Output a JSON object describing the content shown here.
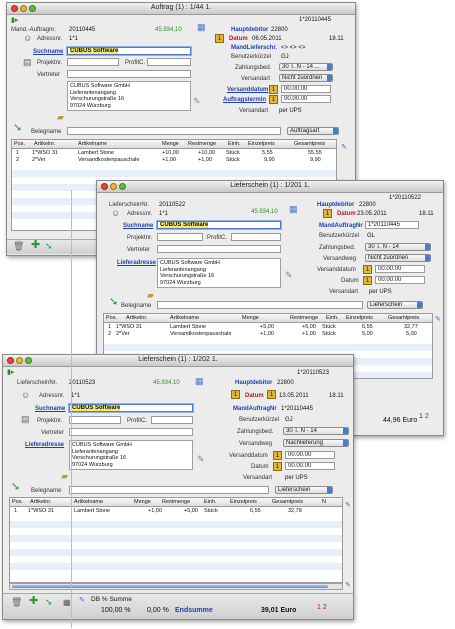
{
  "w1": {
    "title": "Auftrag (1) : 1/44 1.",
    "doc_no": "1*20110445",
    "lbl_mand": "Mand.-Auftragnr.",
    "mand": "20110445",
    "amount": "45.934,10",
    "lbl_hauptdebitor": "Hauptdebitor",
    "hauptdebitor": "22800",
    "lbl_datum": "Datum",
    "datum": "06.05.2011",
    "time": "18.11",
    "lbl_adressnr": "Adressnr.",
    "adressnr": "1*1",
    "lbl_mandlieferschein": "MandLieferschr.",
    "mandlieferschein": "<> <> <>",
    "lbl_suchname": "Suchname",
    "suchname": "CUBUS Software",
    "lbl_benutzer": "Benutzerkürzel",
    "benutzer": "GJ",
    "lbl_projekt": "Projektnr.",
    "lbl_profitc": "ProfitC.",
    "lbl_zahlung": "Zahlungsbed.",
    "zahlung": "30 T. N - 14 ...",
    "lbl_vertreter": "Vertreter",
    "lbl_versandart": "Versandart",
    "versandart": "Nicht zuordnen",
    "address": [
      "CUBUS Software GmbH",
      "Lieferantenangang",
      "Verschurungstraße 16",
      "97024 Würzburg"
    ],
    "lbl_versanddatum": "Versanddatum",
    "versanddatum": "00.00.00",
    "lbl_auftragstermin": "Auftragstermin",
    "auftragstermin": "00.00.00",
    "lbl_versandart2": "Versandart",
    "versandart2": "per UPS",
    "lbl_belegname": "Belegname",
    "belegname": "Auftragsart",
    "columns": [
      "Pos.",
      "Artikelnr.",
      "Artikelname",
      "Menge",
      "Restmenge",
      "Einh.",
      "Einzelpreis",
      "Gesamtpreis"
    ],
    "rows": [
      [
        "1",
        "1*WSO 31",
        "Lambert Stone",
        "+10,00",
        "+10,00",
        "Stück",
        "5,55",
        "55,55"
      ],
      [
        "2",
        "2*Ver",
        "Versandkostenpauschale",
        "+1,00",
        "+1,00",
        "Stück",
        "9,90",
        "9,90"
      ]
    ]
  },
  "w2": {
    "title": "Lieferschein (1) : 1/201 1.",
    "doc_no": "1*20110522",
    "lbl_mand": "LieferscheinNr.",
    "mand": "20110522",
    "amount": "45.934,10",
    "lbl_hauptdebitor": "Hauptdebitor",
    "hauptdebitor": "22800",
    "lbl_datum": "Datum",
    "datum": "23.05.2011",
    "time": "18.11",
    "lbl_adressnr": "Adressnr.",
    "adressnr": "1*1",
    "lbl_mandauftragnr": "MandAuftragNr",
    "mandauftragnr": "1*20110445",
    "lbl_suchname": "Suchname",
    "suchname": "CUBUS Software",
    "lbl_benutzer": "Benutzerkürzel",
    "benutzer": "GL",
    "lbl_projekt": "Projektnr.",
    "lbl_profitc": "ProfitC.",
    "lbl_zahlung": "Zahlungsbed.",
    "zahlung": "30 T. N - 14",
    "lbl_vertreter": "Vertreter",
    "lbl_versandweg": "Versandweg",
    "versandweg": "Nicht zuordnen",
    "lbl_lieferadresse": "Lieferadresse",
    "address": [
      "CUBUS Software GmbH",
      "Lieferantenangang",
      "Verschurungstraße 16",
      "97024 Würzburg"
    ],
    "lbl_versanddatum": "Versanddatum",
    "versanddatum": "00.00.00",
    "lbl_datum2": "Datum",
    "datum2": "00.00.00",
    "lbl_versandart": "Versandart",
    "versandart": "per UPS",
    "lbl_belegname": "Belegname",
    "belegname": "Lieferschein",
    "columns": [
      "Pos.",
      "Artikelnr.",
      "Artikelname",
      "Menge",
      "Restmenge",
      "Einh.",
      "Einzelpreis",
      "Gesamtpreis"
    ],
    "rows": [
      [
        "1",
        "1*WSO 31",
        "Lambert Stone",
        "+5,00",
        "+5,00",
        "Stück",
        "6,55",
        "32,77"
      ],
      [
        "2",
        "2*Ver",
        "Versandkostenpauschale",
        "+1,00",
        "+1,00",
        "Stück",
        "5,00",
        "5,00"
      ]
    ],
    "total": "44,96",
    "currency": "Euro",
    "page_a": "1",
    "page_b": "2"
  },
  "w3": {
    "title": "Lieferschein (1) : 1/202 1.",
    "doc_no": "1*20110523",
    "lbl_mand": "LieferscheinNr.",
    "mand": "20110523",
    "amount": "45.934,10",
    "lbl_hauptdebitor": "Hauptdebitor",
    "hauptdebitor": "22800",
    "lbl_datum": "Datum",
    "datum": "13.05.2011",
    "time": "18.11",
    "lbl_adressnr": "Adressnr.",
    "adressnr": "1*1",
    "lbl_mandauftragnr": "MandAuftragNr",
    "mandauftragnr": "1*20110445",
    "lbl_suchname": "Suchname",
    "suchname": "CUBUS Software",
    "lbl_benutzer": "Benutzerkürzel",
    "benutzer": "GJ",
    "lbl_projekt": "Projektnr.",
    "lbl_profitc": "ProfitC.",
    "lbl_zahlung": "Zahlungsbed.",
    "zahlung": "30 T. N - 14",
    "lbl_vertreter": "Vertreter",
    "lbl_versandweg": "Versandweg",
    "versandweg": "Nachlieferung",
    "lbl_lieferadresse": "Lieferadresse",
    "address": [
      "CUBUS Software GmbH",
      "Lieferantenangang",
      "Verschurungstraße 16",
      "97024 Würzburg"
    ],
    "lbl_versanddatum": "Versanddatum",
    "versanddatum": "00.00.00",
    "lbl_datum2": "Datum",
    "datum2": "00.00.00",
    "lbl_versandart": "Versandart",
    "versandart": "per UPS",
    "lbl_belegname": "Belegname",
    "belegname": "Lieferschein",
    "columns": [
      "Pos.",
      "Artikelnr.",
      "Artikelname",
      "Menge",
      "Restmenge",
      "Einh.",
      "Einzelpreis",
      "Gesamtpreis",
      "N"
    ],
    "rows": [
      [
        "1",
        "1*WSO 31",
        "Lambert Stone",
        "+1,00",
        "+5,00",
        "Stück",
        "6,55",
        "32,78"
      ]
    ],
    "db_label": "DB %",
    "summe_label": "Summe",
    "pct": "100,00 %",
    "pct2": "0,00 %",
    "endsumme_label": "Endsumme",
    "endsumme": "39,01",
    "currency": "Euro",
    "page_a": "1",
    "page_b": "2"
  }
}
